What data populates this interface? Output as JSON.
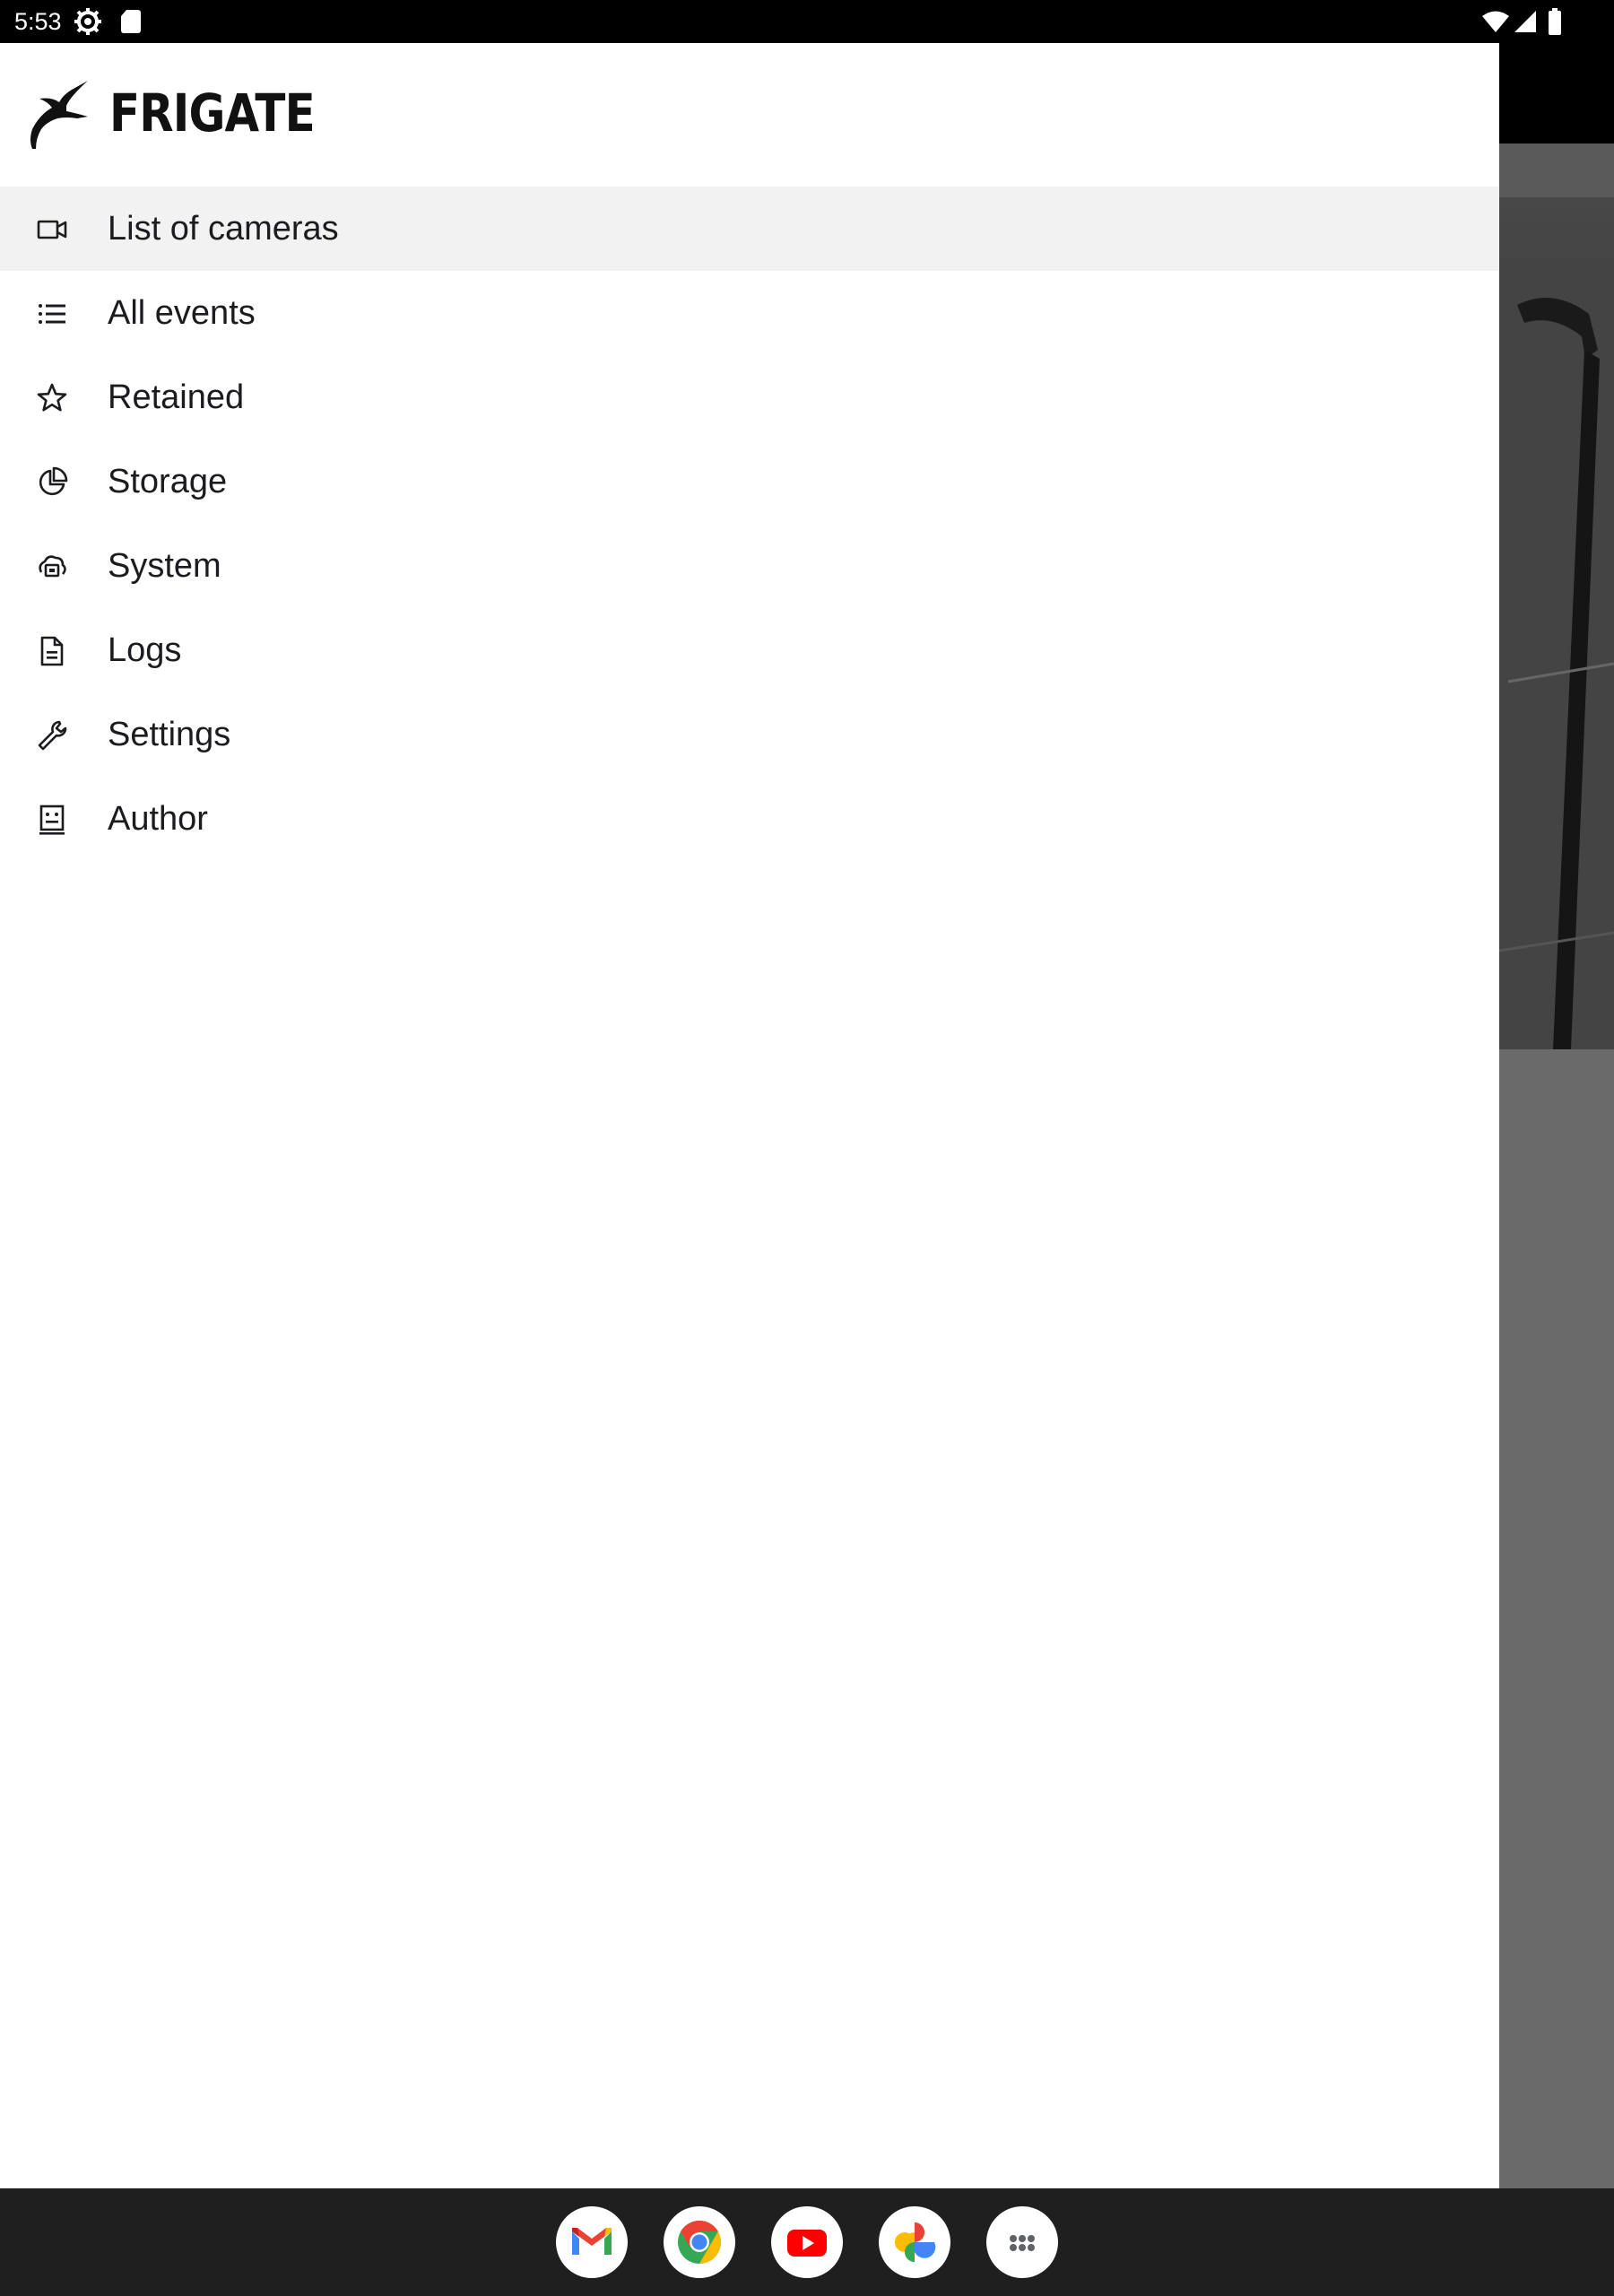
{
  "status_bar": {
    "time": "5:53",
    "icons": [
      "gear-icon",
      "sd-card-icon",
      "wifi-icon",
      "signal-icon",
      "battery-icon"
    ]
  },
  "drawer": {
    "app_name": "FRIGATE",
    "logo_icon": "frigate-bird-logo",
    "items": [
      {
        "label": "List of cameras",
        "icon": "videocam-icon",
        "active": true
      },
      {
        "label": "All events",
        "icon": "list-icon",
        "active": false
      },
      {
        "label": "Retained",
        "icon": "star-icon",
        "active": false
      },
      {
        "label": "Storage",
        "icon": "pie-chart-icon",
        "active": false
      },
      {
        "label": "System",
        "icon": "system-icon",
        "active": false
      },
      {
        "label": "Logs",
        "icon": "document-icon",
        "active": false
      },
      {
        "label": "Settings",
        "icon": "wrench-icon",
        "active": false
      },
      {
        "label": "Author",
        "icon": "author-icon",
        "active": false
      }
    ]
  },
  "taskbar": {
    "apps": [
      "gmail-icon",
      "chrome-icon",
      "youtube-icon",
      "google-photos-icon",
      "app-drawer-icon"
    ]
  },
  "colors": {
    "status_bar": "#000000",
    "drawer_background": "#ffffff",
    "active_item_background": "#f2f2f2",
    "scrim": "#6a6a6a",
    "taskbar": "#1f1f1f"
  }
}
